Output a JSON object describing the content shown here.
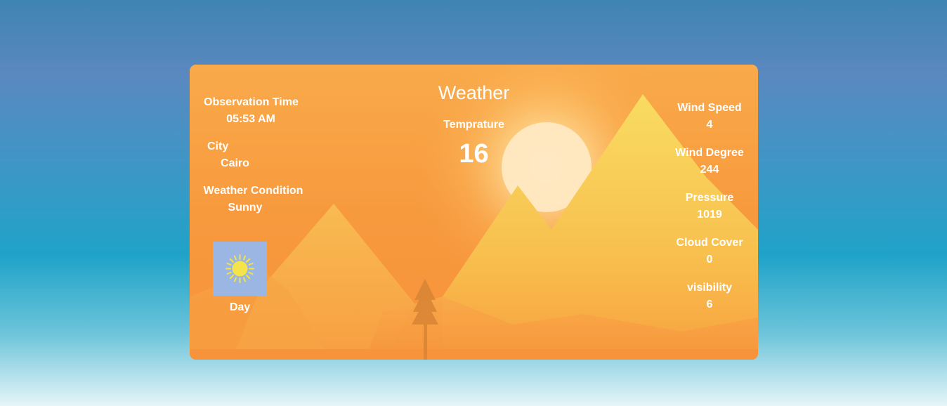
{
  "header": {
    "title": "Weather"
  },
  "temperature": {
    "label": "Temprature",
    "value": "16"
  },
  "left_panel": {
    "observation_time_label": "Observation Time",
    "observation_time_value": "05:53 AM",
    "city_label": "City",
    "city_value": "Cairo",
    "condition_label": "Weather Condition",
    "condition_value": "Sunny",
    "weather_icon": "sun-icon",
    "period": "Day"
  },
  "right_panel": {
    "wind_speed_label": "Wind Speed",
    "wind_speed_value": "4",
    "wind_degree_label": "Wind Degree",
    "wind_degree_value": "244",
    "pressure_label": "Pressure",
    "pressure_value": "1019",
    "cloud_cover_label": "Cloud Cover",
    "cloud_cover_value": "0",
    "visibility_label": "visibility",
    "visibility_value": "6"
  },
  "colors": {
    "card_orange": "#f79a3e",
    "mountain_yellow": "#f8d55e",
    "icon_background": "#9bb6e2",
    "sun_icon": "#f5e34a"
  }
}
